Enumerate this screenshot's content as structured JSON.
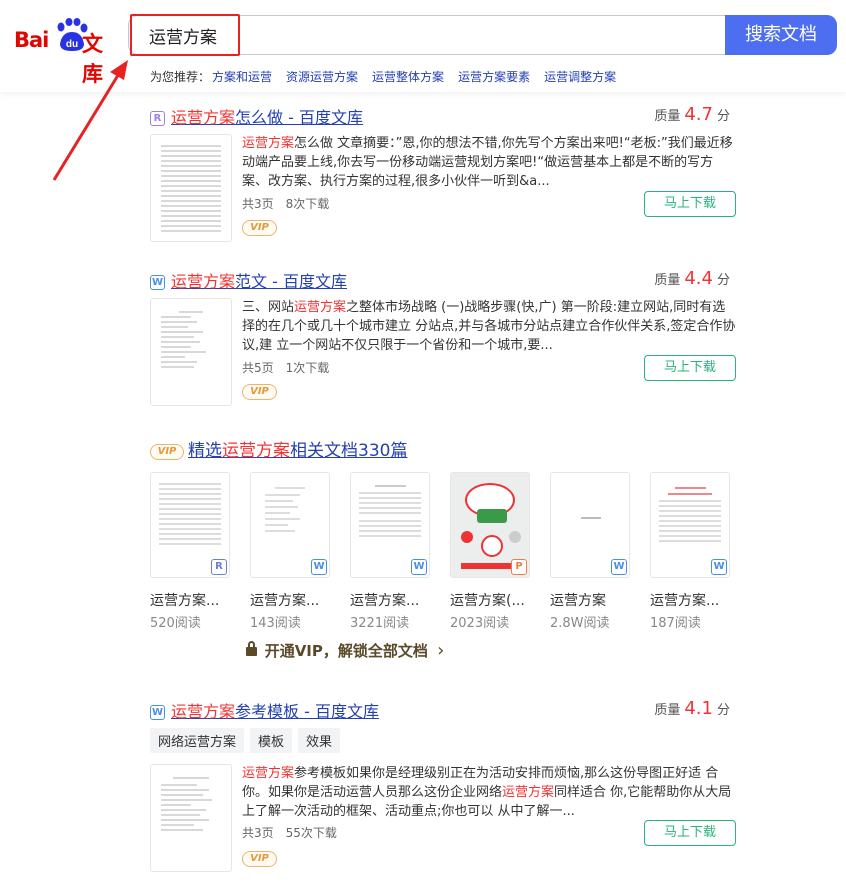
{
  "logo": {
    "bai": "Bai",
    "du": "du",
    "wenku": "文库"
  },
  "search": {
    "query": "运营方案",
    "button_label": "搜索文档"
  },
  "recommend": {
    "label": "为您推荐：",
    "links": [
      "方案和运营",
      "资源运营方案",
      "运营整体方案",
      "运营方案要素",
      "运营调整方案"
    ]
  },
  "results": [
    {
      "type_icon": "R",
      "title_em": "运营方案",
      "title_rest": "怎么做 - 百度文库",
      "quality_label": "质量",
      "quality_value": "4.7",
      "quality_unit": "分",
      "snippet_em": "运营方案",
      "snippet_rest": "怎么做 文章摘要：”恩,你的想法不错,你先写个方案出来吧!“老板:”我们最近移动端产品要上线,你去写一份移动端运营规划方案吧!“做运营基本上都是不断的写方案、改方案、执行方案的过程,很多小伙伴一听到&a...",
      "pages": "共3页",
      "downloads": "8次下载",
      "vip": "VIP",
      "download_label": "马上下载"
    },
    {
      "type_icon": "W",
      "title_em": "运营方案",
      "title_rest": "范文 - 百度文库",
      "quality_label": "质量",
      "quality_value": "4.4",
      "quality_unit": "分",
      "snippet_pre": "三、网站",
      "snippet_em": "运营方案",
      "snippet_rest": "之整体市场战略 (一)战略步骤(快,广) 第一阶段:建立网站,同时有选择的在几个或几十个城市建立 分站点,并与各城市分站点建立合作伙伴关系,签定合作协议,建 立一个网站不仅只限于一个省份和一个城市,要...",
      "pages": "共5页",
      "downloads": "1次下载",
      "vip": "VIP",
      "download_label": "马上下载"
    },
    {
      "type_icon": "W",
      "title_em": "运营方案",
      "title_rest": "参考模板 - 百度文库",
      "quality_label": "质量",
      "quality_value": "4.1",
      "quality_unit": "分",
      "tags": [
        "网络运营方案",
        "模板",
        "效果"
      ],
      "snippet_em": "运营方案",
      "snippet_mid": "参考模板如果你是经理级别正在为活动安排而烦恼,那么这份导图正好适 合你。如果你是活动运营人员那么这份企业网络",
      "snippet_em2": "运营方案",
      "snippet_rest": "同样适合 你,它能帮助你从大局上了解一次活动的框架、活动重点;你也可以 从中了解一...",
      "pages": "共3页",
      "downloads": "55次下载",
      "vip": "VIP",
      "download_label": "马上下载"
    }
  ],
  "related": {
    "vip": "VIP",
    "title_pre": "精选",
    "title_em": "运营方案",
    "title_rest": "相关文档330篇",
    "cards": [
      {
        "name": "运营方案...",
        "reads": "520阅读",
        "badge": "R"
      },
      {
        "name": "运营方案...",
        "reads": "143阅读",
        "badge": "W"
      },
      {
        "name": "运营方案...",
        "reads": "3221阅读",
        "badge": "W"
      },
      {
        "name": "运营方案(...",
        "reads": "2023阅读",
        "badge": "P"
      },
      {
        "name": "运营方案",
        "reads": "2.8W阅读",
        "badge": "W"
      },
      {
        "name": "运营方案...",
        "reads": "187阅读",
        "badge": "W"
      }
    ],
    "unlock_label": "开通VIP，解锁全部文档",
    "unlock_chevron": "›"
  },
  "colors": {
    "accent": "#4e6ef2",
    "highlight": "#f73131",
    "link": "#2440b3",
    "download": "#2ab27b",
    "annotation": "#e62222"
  }
}
